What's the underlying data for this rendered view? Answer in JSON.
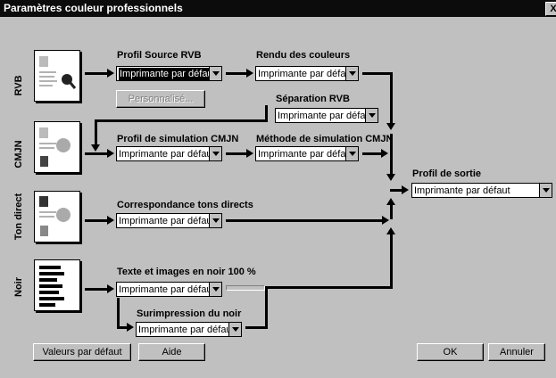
{
  "window": {
    "title": "Paramètres couleur professionnels",
    "close_label": "X"
  },
  "rows": {
    "rvb": "RVB",
    "cmjn": "CMJN",
    "ton_direct": "Ton direct",
    "noir": "Noir"
  },
  "fields": {
    "profil_source": {
      "label": "Profil Source RVB",
      "value": "Imprimante par défaut"
    },
    "rendu": {
      "label": "Rendu des couleurs",
      "value": "Imprimante par défaut"
    },
    "separation": {
      "label": "Séparation RVB",
      "value": "Imprimante par défaut"
    },
    "simulation": {
      "label": "Profil de simulation CMJN",
      "value": "Imprimante par défaut"
    },
    "methode": {
      "label": "Méthode de simulation CMJN",
      "value": "Imprimante par défaut"
    },
    "tons_directs": {
      "label": "Correspondance tons directs",
      "value": "Imprimante par défaut"
    },
    "noir_100": {
      "label": "Texte et images en noir 100 %",
      "value": "Imprimante par défaut"
    },
    "surimpression": {
      "label": "Surimpression du noir",
      "value": "Imprimante par défaut"
    },
    "sortie": {
      "label": "Profil de sortie",
      "value": "Imprimante par défaut"
    }
  },
  "buttons": {
    "personnalise": "Personnalisé...",
    "valeurs_defaut": "Valeurs par défaut",
    "aide": "Aide",
    "ok": "OK",
    "annuler": "Annuler"
  }
}
